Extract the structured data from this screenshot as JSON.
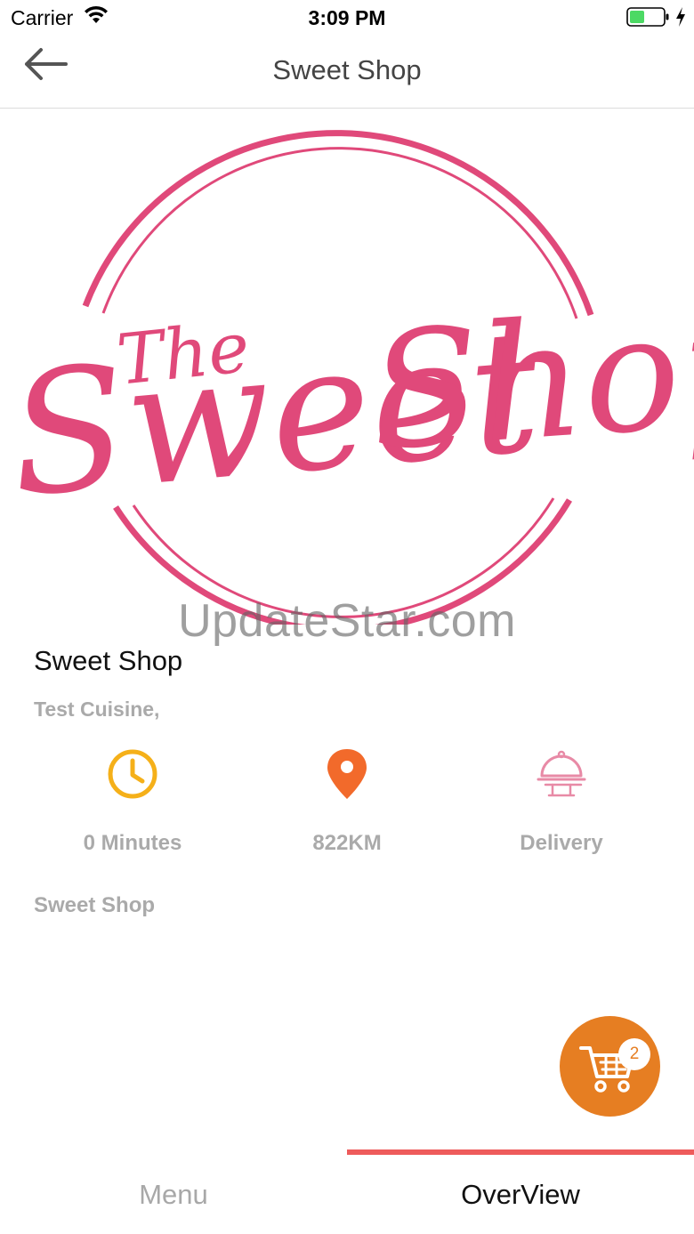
{
  "status_bar": {
    "carrier": "Carrier",
    "time": "3:09 PM",
    "battery_color": "#4cd964"
  },
  "nav": {
    "title": "Sweet Shop",
    "back_icon": "arrow-left-icon"
  },
  "banner": {
    "logo_line1": "The",
    "logo_line2": "Sweet Shop",
    "logo_color": "#e0497a",
    "watermark": "UpdateStar.com"
  },
  "shop": {
    "name": "Sweet Shop",
    "cuisine": "Test Cuisine,",
    "description": "Sweet Shop"
  },
  "info": [
    {
      "icon": "clock-icon",
      "label": "0 Minutes",
      "color": "#f5b019"
    },
    {
      "icon": "location-pin-icon",
      "label": "822KM",
      "color": "#f26a2b"
    },
    {
      "icon": "food-cloche-icon",
      "label": "Delivery",
      "color": "#e88aa6"
    }
  ],
  "cart": {
    "icon": "shopping-cart-icon",
    "count": "2",
    "color": "#e67e22"
  },
  "tabs": [
    {
      "label": "Menu",
      "active": false
    },
    {
      "label": "OverView",
      "active": true
    }
  ],
  "accent_color": "#ee5b5b"
}
